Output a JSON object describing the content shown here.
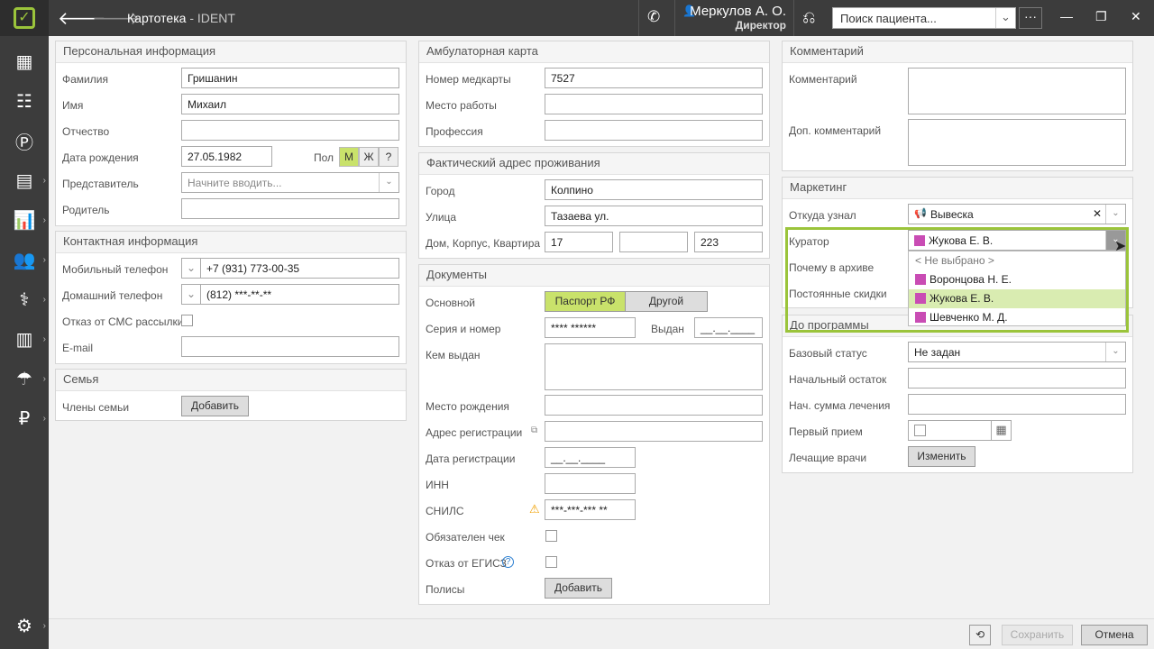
{
  "header": {
    "title": "Картотека",
    "subtitle": "- IDENT",
    "user_name": "Меркулов А. О.",
    "user_role": "Директор",
    "search_placeholder": "Поиск пациента...",
    "more": "···"
  },
  "personal": {
    "heading": "Персональная информация",
    "lastname_label": "Фамилия",
    "lastname": "Гришанин",
    "firstname_label": "Имя",
    "firstname": "Михаил",
    "patronymic_label": "Отчество",
    "patronymic": "",
    "birthdate_label": "Дата рождения",
    "birthdate": "27.05.1982",
    "gender_label": "Пол",
    "gender_m": "М",
    "gender_f": "Ж",
    "gender_q": "?",
    "representative_label": "Представитель",
    "representative_placeholder": "Начните вводить...",
    "parent_label": "Родитель",
    "parent": ""
  },
  "contacts": {
    "heading": "Контактная информация",
    "mobile_label": "Мобильный телефон",
    "mobile": "+7 (931) 773-00-35",
    "home_label": "Домашний телефон",
    "home": "(812) ***-**-**",
    "sms_label": "Отказ от СМС рассылки",
    "email_label": "E-mail"
  },
  "family": {
    "heading": "Семья",
    "members_label": "Члены семьи",
    "add": "Добавить"
  },
  "card": {
    "heading": "Амбулаторная карта",
    "number_label": "Номер медкарты",
    "number": "7527",
    "work_label": "Место работы",
    "profession_label": "Профессия"
  },
  "address": {
    "heading": "Фактический адрес проживания",
    "city_label": "Город",
    "city": "Колпино",
    "street_label": "Улица",
    "street": "Тазаева ул.",
    "house_label": "Дом, Корпус, Квартира",
    "house": "17",
    "building": "",
    "flat": "223"
  },
  "documents": {
    "heading": "Документы",
    "main_label": "Основной",
    "passport": "Паспорт РФ",
    "other": "Другой",
    "series_label": "Серия и номер",
    "series": "**** ******",
    "issued_label": "Выдан",
    "issued": "__.__.____",
    "issuer_label": "Кем выдан",
    "birthplace_label": "Место рождения",
    "reg_address_label": "Адрес регистрации",
    "reg_date_label": "Дата регистрации",
    "reg_date": "__.__.____",
    "inn_label": "ИНН",
    "snils_label": "СНИЛС",
    "snils": "***-***-*** **",
    "receipt_label": "Обязателен чек",
    "egisz_label": "Отказ от ЕГИСЗ",
    "policies_label": "Полисы",
    "add": "Добавить"
  },
  "comment": {
    "heading": "Комментарий",
    "comment_label": "Комментарий",
    "extra_label": "Доп. комментарий"
  },
  "marketing": {
    "heading": "Маркетинг",
    "source_label": "Откуда узнал",
    "source": "Вывеска",
    "curator_label": "Куратор",
    "curator": "Жукова Е. В.",
    "archive_label": "Почему в архиве",
    "discount_label": "Постоянные скидки",
    "curator_options": [
      "< Не выбрано >",
      "Воронцова Н. Е.",
      "Жукова Е. В.",
      "Шевченко М. Д."
    ]
  },
  "program": {
    "heading": "До программы",
    "status_label": "Базовый статус",
    "status": "Не задан",
    "balance_label": "Начальный остаток",
    "sum_label": "Нач. сумма лечения",
    "first_label": "Первый прием",
    "doctors_label": "Лечащие врачи",
    "change": "Изменить"
  },
  "footer": {
    "save": "Сохранить",
    "cancel": "Отмена"
  },
  "colors": {
    "accent": "#9bc43b",
    "curator_tag": "#c94cb4"
  }
}
